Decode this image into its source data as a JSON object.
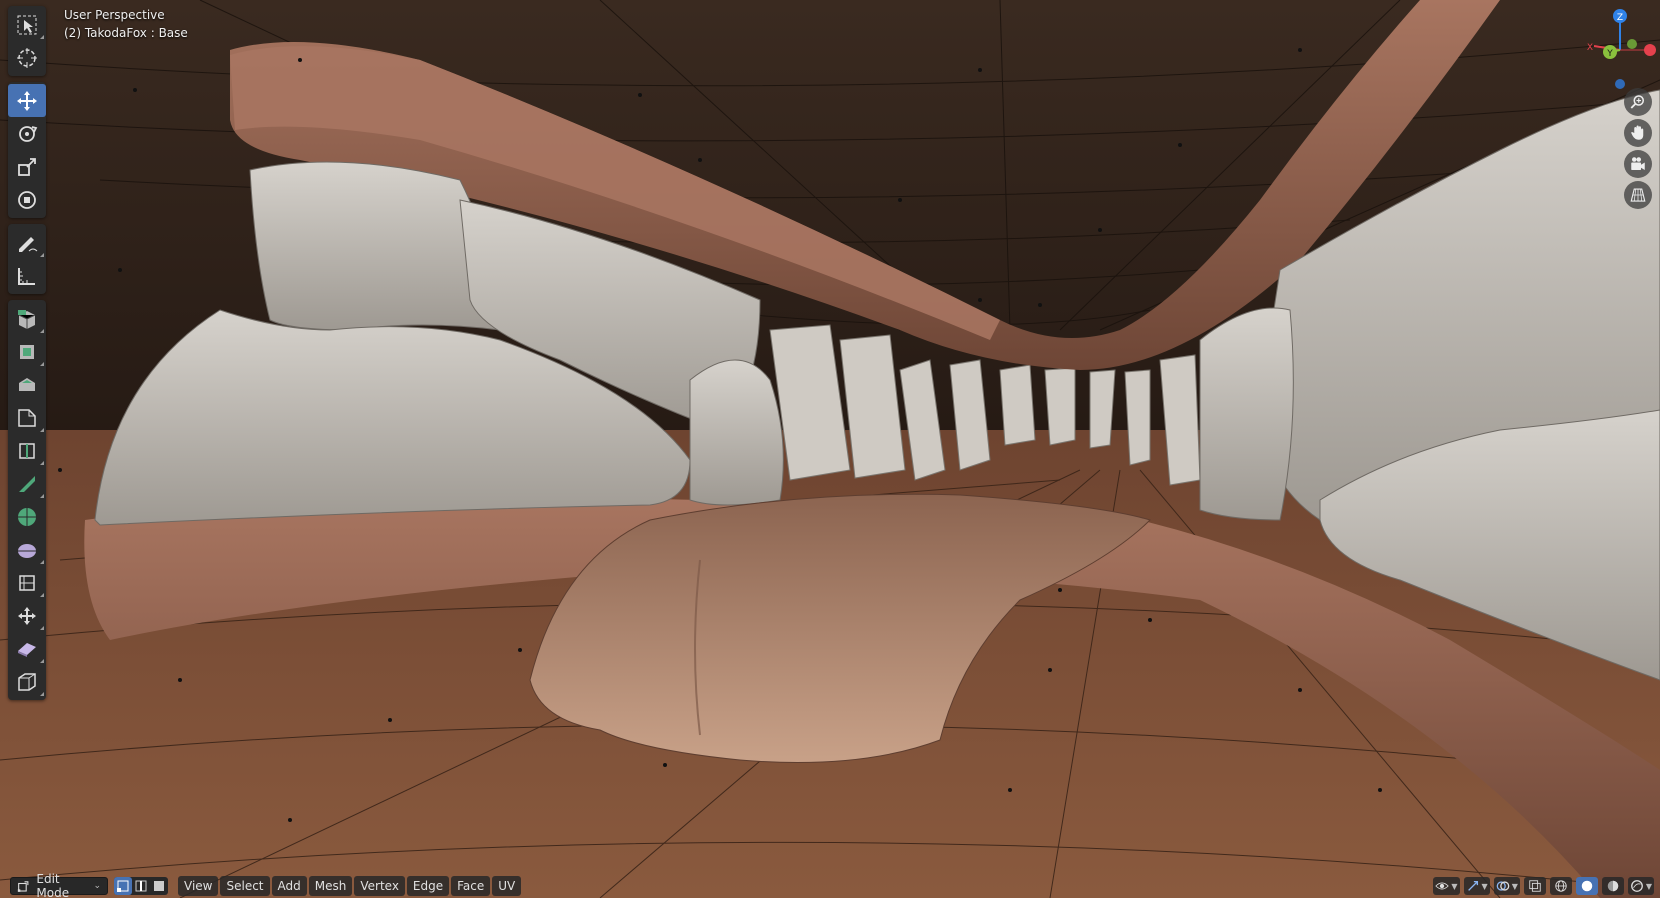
{
  "viewport": {
    "view_name": "User Perspective",
    "object_info": "(2) TakodaFox : Base"
  },
  "toolbar": {
    "tools": [
      {
        "name": "select-box",
        "active": false
      },
      {
        "name": "cursor",
        "active": false
      },
      {
        "name": "move",
        "active": true
      },
      {
        "name": "rotate",
        "active": false
      },
      {
        "name": "scale",
        "active": false
      },
      {
        "name": "transform",
        "active": false
      },
      {
        "name": "annotate",
        "active": false
      },
      {
        "name": "measure",
        "active": false
      },
      {
        "name": "add-cube",
        "active": false
      },
      {
        "name": "extrude-region",
        "active": false
      },
      {
        "name": "inset-faces",
        "active": false
      },
      {
        "name": "bevel",
        "active": false
      },
      {
        "name": "loop-cut",
        "active": false
      },
      {
        "name": "knife",
        "active": false
      },
      {
        "name": "poly-build",
        "active": false
      },
      {
        "name": "spin",
        "active": false
      },
      {
        "name": "smooth",
        "active": false
      },
      {
        "name": "edge-slide",
        "active": false
      },
      {
        "name": "shrink-fatten",
        "active": false
      },
      {
        "name": "shear",
        "active": false
      },
      {
        "name": "rip-region",
        "active": false
      }
    ]
  },
  "gizmo": {
    "axes": {
      "x": "X",
      "y": "Y",
      "z": "Z"
    },
    "colors": {
      "x": "#e5414d",
      "y": "#8ac03d",
      "z": "#2f82e8"
    }
  },
  "nav_buttons": [
    "zoom-icon",
    "hand-pan-icon",
    "camera-icon",
    "grid-perspective-icon"
  ],
  "header": {
    "mode": "Edit Mode",
    "menus": [
      "View",
      "Select",
      "Add",
      "Mesh",
      "Vertex",
      "Edge",
      "Face",
      "UV"
    ]
  },
  "colors": {
    "accent": "#4772b3",
    "floor": "#8a5a3e",
    "teeth": "#c8c3bb",
    "gum": "#9a6a52"
  }
}
